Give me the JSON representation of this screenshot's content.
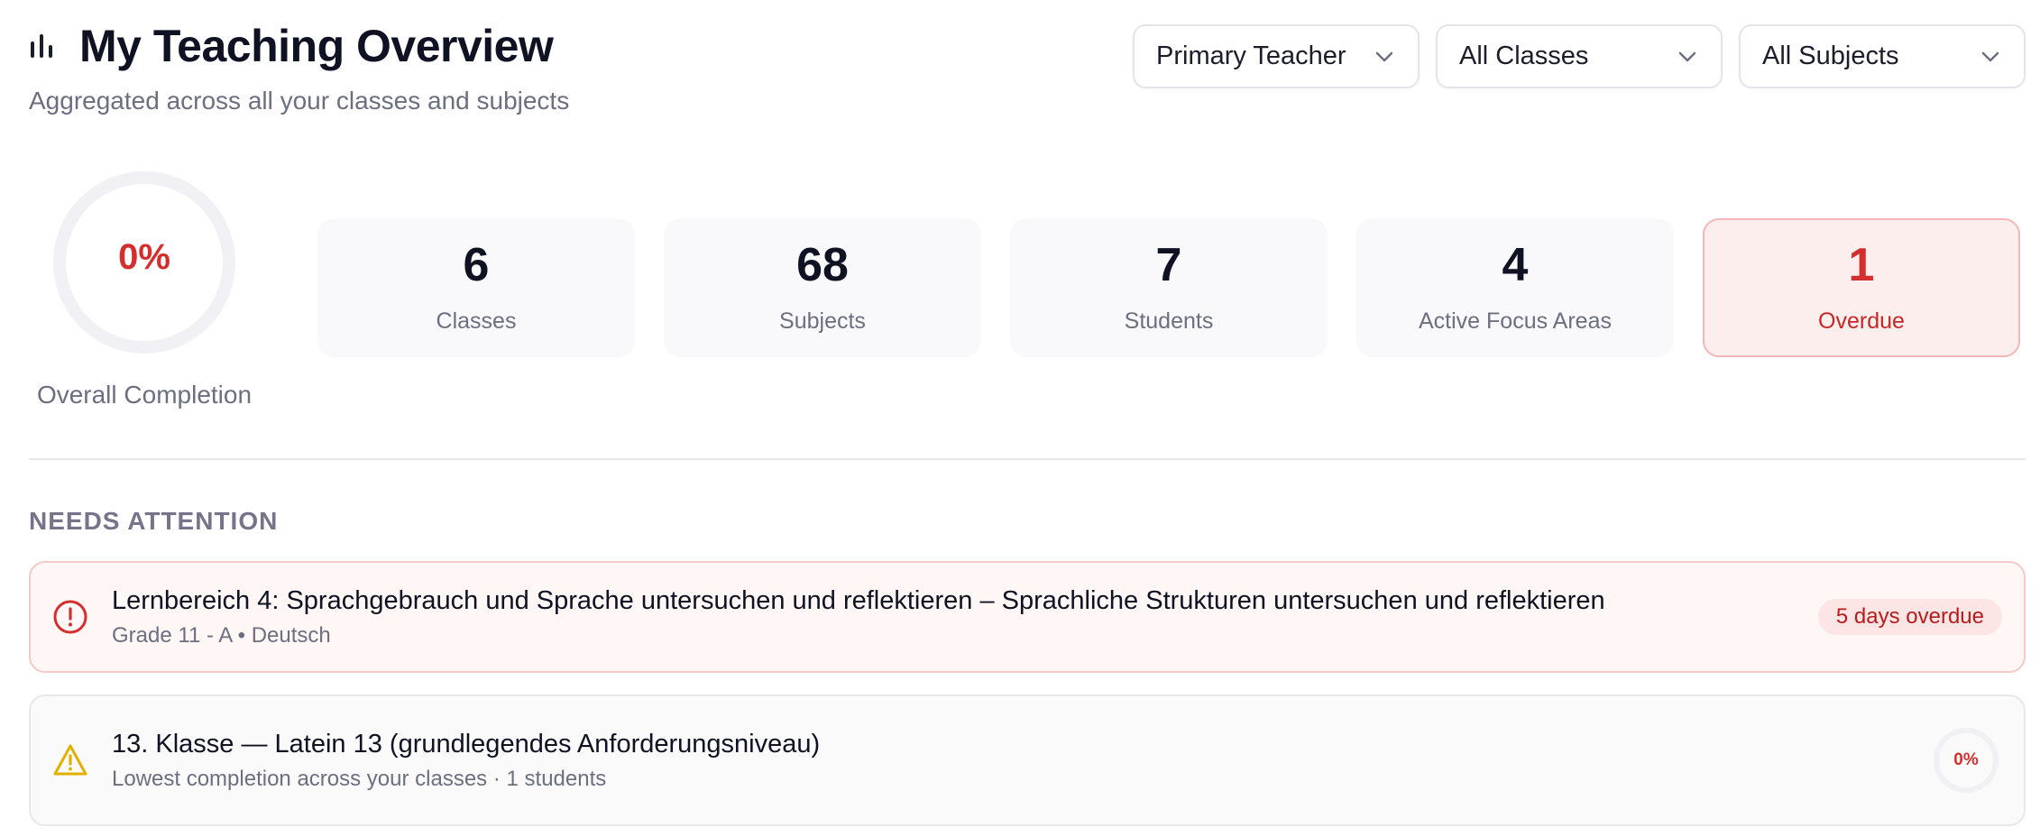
{
  "header": {
    "title": "My Teaching Overview",
    "subtitle": "Aggregated across all your classes and subjects",
    "icon": "bar-chart-icon"
  },
  "filters": {
    "role": "Primary Teacher",
    "classes": "All Classes",
    "subjects": "All Subjects"
  },
  "completion": {
    "value_text": "0%",
    "value": 0,
    "label": "Overall Completion"
  },
  "stats": [
    {
      "value": "6",
      "label": "Classes"
    },
    {
      "value": "68",
      "label": "Subjects"
    },
    {
      "value": "7",
      "label": "Students"
    },
    {
      "value": "4",
      "label": "Active Focus Areas"
    },
    {
      "value": "1",
      "label": "Overdue"
    }
  ],
  "attention": {
    "title": "NEEDS ATTENTION",
    "items": [
      {
        "title": "Lernbereich 4: Sprachgebrauch und Sprache untersuchen und reflektieren – Sprachliche Strukturen untersuchen und reflektieren",
        "subtitle": "Grade 11 - A • Deutsch",
        "badge": "5 days overdue",
        "icon": "alert-circle-icon",
        "color": "#d32f2f"
      },
      {
        "title": "13. Klasse — Latein 13 (grundlegendes Anforderungsniveau)",
        "subtitle": "Lowest completion across your classes · 1 students",
        "completion_text": "0%",
        "completion": 0,
        "icon": "warning-triangle-icon",
        "color": "#e0b100"
      }
    ]
  },
  "colors": {
    "danger": "#d32f2f",
    "warning": "#e0b100",
    "muted": "#6b6f80"
  }
}
